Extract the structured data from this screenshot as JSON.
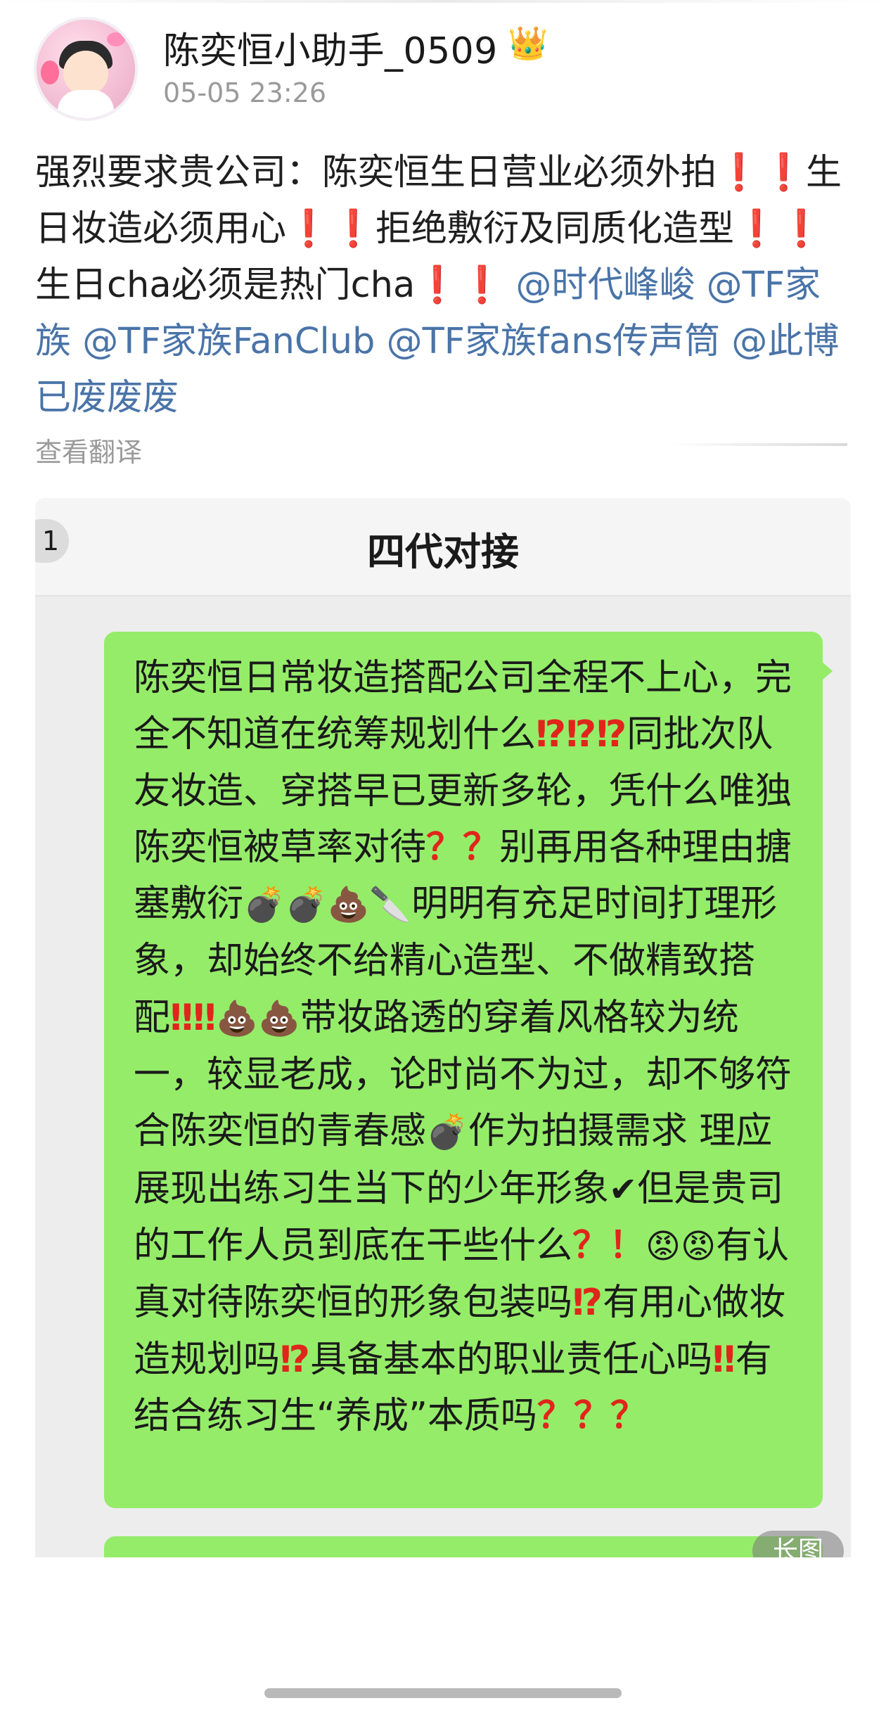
{
  "user": {
    "name": "陈奕恒小助手_0509",
    "time": "05-05 23:26",
    "badge_icon": "crown-icon"
  },
  "post": {
    "segments": [
      {
        "t": "强烈要求贵公司：陈奕恒生日营业必须外拍",
        "c": "text"
      },
      {
        "t": "❗❗",
        "c": "ex"
      },
      {
        "t": "生日妆造必须用心",
        "c": "text"
      },
      {
        "t": "❗❗",
        "c": "ex"
      },
      {
        "t": "拒绝敷衍及同质化造型",
        "c": "text"
      },
      {
        "t": "❗❗",
        "c": "ex"
      },
      {
        "t": "生日cha必须是热门cha",
        "c": "text"
      },
      {
        "t": "❗❗",
        "c": "ex"
      },
      {
        "t": " @时代峰峻 @TF家族 @TF家族FanClub @TF家族fans传声筒 @此博已废废废",
        "c": "mention"
      }
    ],
    "translate_label": "查看翻译"
  },
  "chat": {
    "title": "四代对接",
    "unread": "1",
    "long_image_label": "长图",
    "message_html_segments": [
      {
        "t": "陈奕恒日常妆造搭配公司全程不上心，完全不知道在统筹规划什么",
        "c": "text"
      },
      {
        "t": "⁉⁉⁉",
        "c": "ex"
      },
      {
        "t": "同批次队友妆造、穿搭早已更新多轮，凭什么唯独陈奕恒被草率对待",
        "c": "text"
      },
      {
        "t": "？？",
        "c": "ex"
      },
      {
        "t": "别再用各种理由搪塞敷衍",
        "c": "text"
      },
      {
        "t": "💣💣💩🔪",
        "c": "emoji"
      },
      {
        "t": "明明有充足时间打理形象，却始终不给精心造型、不做精致搭配",
        "c": "text"
      },
      {
        "t": "‼‼",
        "c": "ex"
      },
      {
        "t": "💩💩",
        "c": "emoji"
      },
      {
        "t": "带妆路透的穿着风格较为统一，较显老成，论时尚不为过，却不够符合陈奕恒的青春感",
        "c": "text"
      },
      {
        "t": "💣",
        "c": "emoji"
      },
      {
        "t": "作为拍摄需求 理应展现出练习生当下的少年形象",
        "c": "text"
      },
      {
        "t": "✔",
        "c": "emoji"
      },
      {
        "t": "但是贵司的工作人员到底在干些什么",
        "c": "text"
      },
      {
        "t": "？！",
        "c": "ex"
      },
      {
        "t": "😡😡",
        "c": "emoji"
      },
      {
        "t": "有认真对待陈奕恒的形象包装吗",
        "c": "text"
      },
      {
        "t": "⁉",
        "c": "ex"
      },
      {
        "t": "有用心做妆造规划吗",
        "c": "text"
      },
      {
        "t": "⁉",
        "c": "ex"
      },
      {
        "t": "具备基本的职业责任心吗",
        "c": "text"
      },
      {
        "t": "‼",
        "c": "ex"
      },
      {
        "t": "有结合练习生“养成”本质吗",
        "c": "text"
      },
      {
        "t": "？？？",
        "c": "ex"
      }
    ]
  },
  "colors": {
    "bubble": "#95ec69",
    "mention": "#4a74a8",
    "exclaim": "#e0251b",
    "muted": "#9a9a9a"
  }
}
